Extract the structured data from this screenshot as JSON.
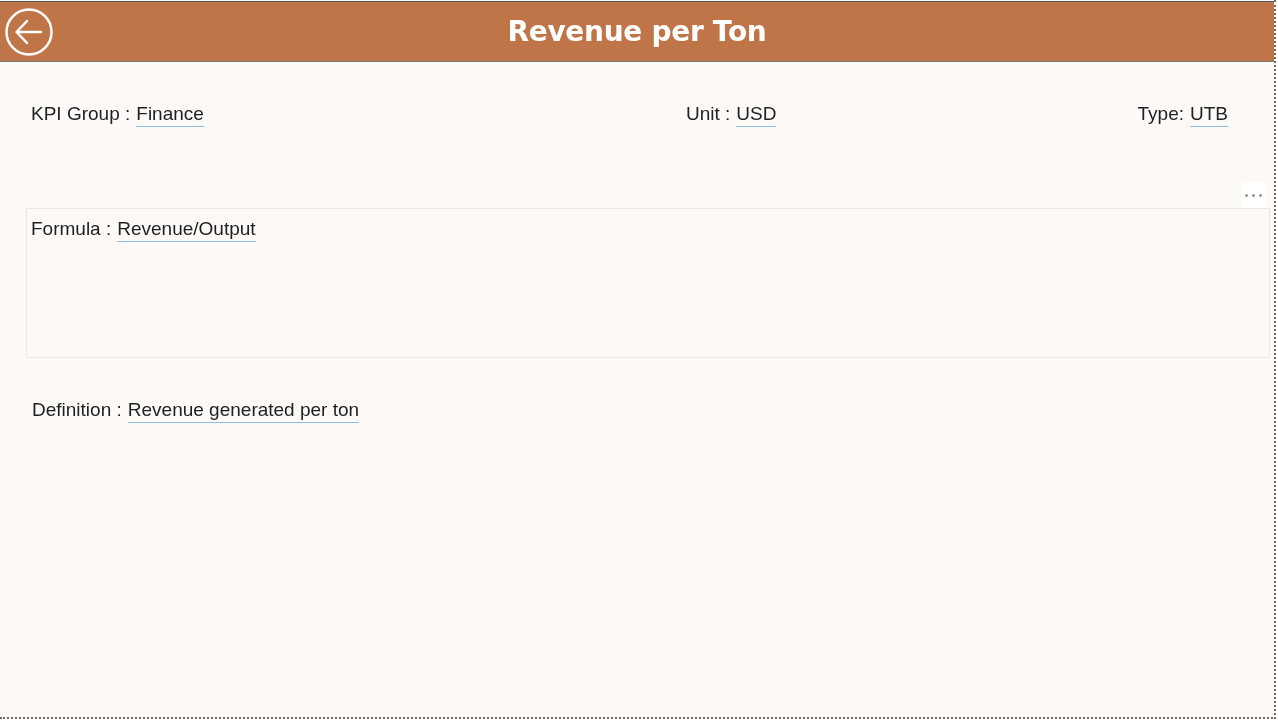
{
  "header": {
    "title": "Revenue per Ton"
  },
  "fields": [
    {
      "label": "KPI Group :",
      "value": "Finance"
    },
    {
      "label": "Unit :",
      "value": "USD"
    },
    {
      "label": "Type:",
      "value": "UTB"
    }
  ],
  "formula": {
    "label": "Formula :",
    "value": "Revenue/Output"
  },
  "definition": {
    "label": "Definition :",
    "value": "Revenue generated per ton"
  }
}
